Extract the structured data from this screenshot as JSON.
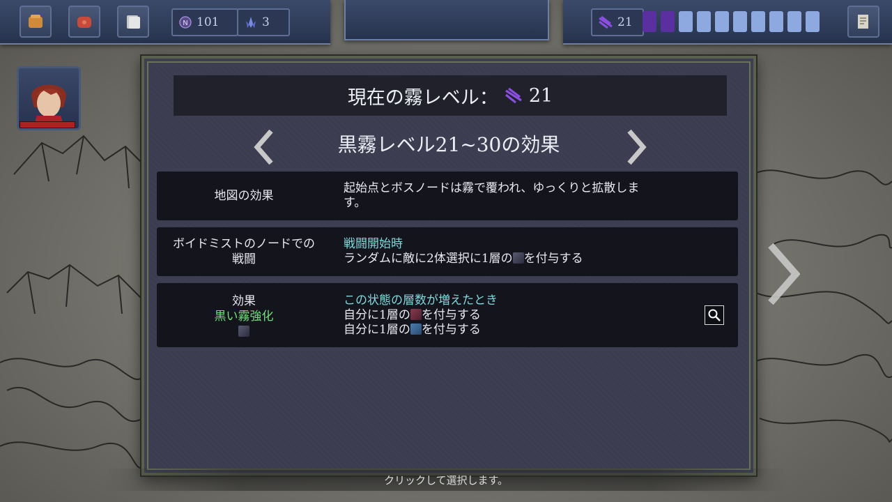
{
  "hud": {
    "left_buttons": [
      {
        "icon": "backpack-icon"
      },
      {
        "icon": "relic-bag-icon"
      },
      {
        "icon": "card-deck-icon"
      }
    ],
    "currency": {
      "icon": "coin-icon",
      "value": "101"
    },
    "crystals": {
      "icon": "crystal-icon",
      "value": "3"
    },
    "fog_counter": {
      "icon": "fog-icon",
      "value": "21"
    },
    "fog_bar": {
      "filled": 2,
      "total": 10,
      "filled_color": "#5a2fa0",
      "empty_color": "#8ea9e0"
    },
    "map_button": {
      "icon": "map-scroll-icon"
    }
  },
  "dialog": {
    "title_prefix": "現在の霧レベル：",
    "title_value": "21",
    "subtitle": "黒霧レベル21~30の効果",
    "rows": [
      {
        "name": "地図の効果",
        "desc_line1": "起始点とボスノードは霧で覆われ、ゆっくりと拡散しま",
        "desc_line2": "す。"
      },
      {
        "name_line1": "ボイドミストのノードでの",
        "name_line2": "戦闘",
        "desc_heading": "戦闘開始時",
        "desc_part1": "ランダムに敵に2体選択に1層の",
        "desc_part2": "を付与する"
      },
      {
        "name_line1": "効果",
        "name_line2": "黒い霧強化",
        "desc_heading": "この状態の層数が増えたとき",
        "desc_a1": "自分に1層の",
        "desc_a2": "を付与する",
        "desc_b1": "自分に1層の",
        "desc_b2": "を付与する"
      }
    ]
  },
  "footer": "クリックして選択します。",
  "colors": {
    "accent_cyan": "#7fd8dc",
    "accent_green": "#6ee07a",
    "fog_purple": "#7a3fd0"
  }
}
